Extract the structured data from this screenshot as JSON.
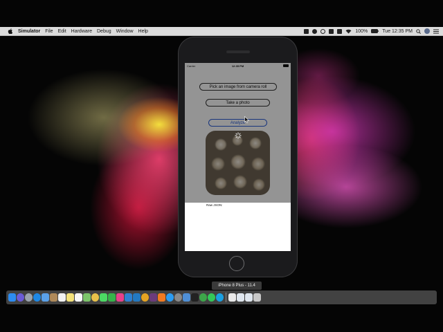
{
  "menubar": {
    "app_name": "Simulator",
    "menus": [
      "File",
      "Edit",
      "Hardware",
      "Debug",
      "Window",
      "Help"
    ],
    "battery": "100%",
    "clock": "Tue 12:35 PM",
    "status_icons": [
      "screen-icon",
      "stop-icon",
      "sync-icon",
      "bluetooth-icon",
      "airplay-icon",
      "wifi-icon",
      "battery-icon",
      "search-icon",
      "avatar",
      "list-icon"
    ]
  },
  "device_tooltip": "iPhone 8 Plus - 11.4",
  "simulator": {
    "carrier": "Carrier",
    "time": "12:35 PM",
    "pick_button": "Pick an image from camera roll",
    "take_button": "Take a photo",
    "analyze_button": "Analyze",
    "raw_json_label": "Raw JSON:",
    "photo_icon": "mushrooms-photo"
  },
  "dock": {
    "icons": [
      "finder-icon",
      "siri-icon",
      "launchpad-icon",
      "safari-icon",
      "mail-icon",
      "contacts-icon",
      "calendar-icon",
      "notes-icon",
      "reminders-icon",
      "maps-icon",
      "photos-icon",
      "messages-icon",
      "facetime-icon",
      "itunes-icon",
      "xcode-icon",
      "vscode-icon",
      "chrome-icon",
      "slack-icon",
      "ibooks-icon",
      "app-store-icon",
      "system-prefs-icon",
      "simulator-icon",
      "terminal-icon",
      "evernote-icon",
      "whatsapp-icon",
      "skype-icon",
      "folder-icon",
      "documents-icon",
      "downloads-icon",
      "trash-icon"
    ]
  }
}
